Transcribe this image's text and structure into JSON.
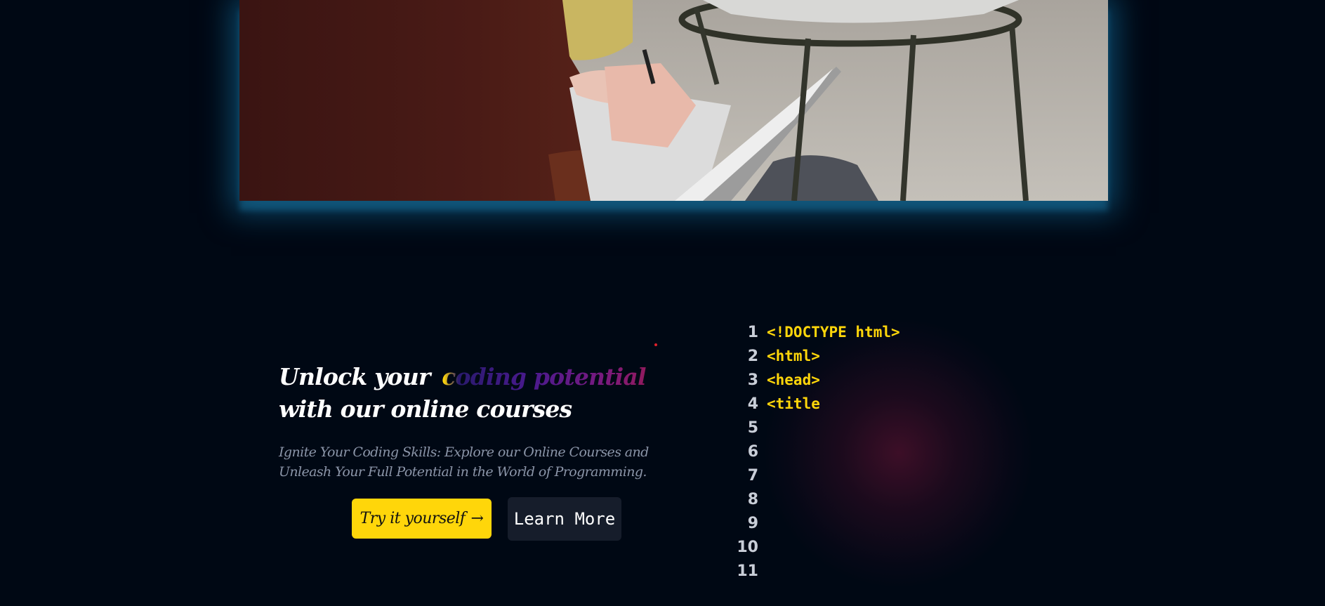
{
  "hero": {
    "image_alt": "Person writing in a notebook next to a metal side table",
    "glow_color": "#1478aa"
  },
  "main": {
    "heading_before": "Unlock your ",
    "heading_highlight": "coding potential",
    "heading_after": " with our online courses",
    "subtitle": "Ignite Your Coding Skills: Explore our Online Courses and Unleash Your Full Potential in the World of Programming.",
    "try_button_label": "Try it yourself",
    "try_button_arrow": "→",
    "learn_button_label": "Learn More"
  },
  "code_editor": {
    "lines": [
      {
        "no": "1",
        "code": "<!DOCTYPE html>"
      },
      {
        "no": "2",
        "code": "<html>"
      },
      {
        "no": "3",
        "code": "<head>"
      },
      {
        "no": "4",
        "code": "<title"
      },
      {
        "no": "5",
        "code": ""
      },
      {
        "no": "6",
        "code": ""
      },
      {
        "no": "7",
        "code": ""
      },
      {
        "no": "8",
        "code": ""
      },
      {
        "no": "9",
        "code": ""
      },
      {
        "no": "10",
        "code": ""
      },
      {
        "no": "11",
        "code": ""
      }
    ]
  },
  "colors": {
    "background": "#000814",
    "accent_yellow": "#ffd60a",
    "secondary_button": "#161d2b",
    "muted_text": "#8b95a8"
  }
}
